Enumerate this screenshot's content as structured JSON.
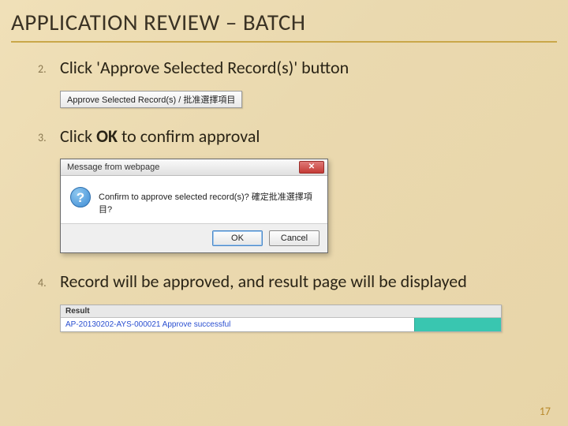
{
  "title": "APPLICATION REVIEW – BATCH",
  "steps": {
    "s2": {
      "num": "2.",
      "text_pre": "Click '",
      "text_mid": "Approve Selected Record(s)",
      "text_post": "' button"
    },
    "s3": {
      "num": "3.",
      "text_pre": "Click ",
      "text_bold": "OK",
      "text_post": " to confirm approval"
    },
    "s4": {
      "num": "4.",
      "text": "Record will be approved, and result page will be displayed"
    }
  },
  "approve_button": {
    "label": "Approve Selected Record(s) / 批准選擇項目"
  },
  "dialog": {
    "title": "Message from webpage",
    "close_glyph": "✕",
    "question_glyph": "?",
    "message": "Confirm to approve selected record(s)? 確定批准選擇項目?",
    "ok": "OK",
    "cancel": "Cancel"
  },
  "result": {
    "header": "Result",
    "row": "AP-20130202-AYS-000021 Approve successful"
  },
  "page_number": "17"
}
